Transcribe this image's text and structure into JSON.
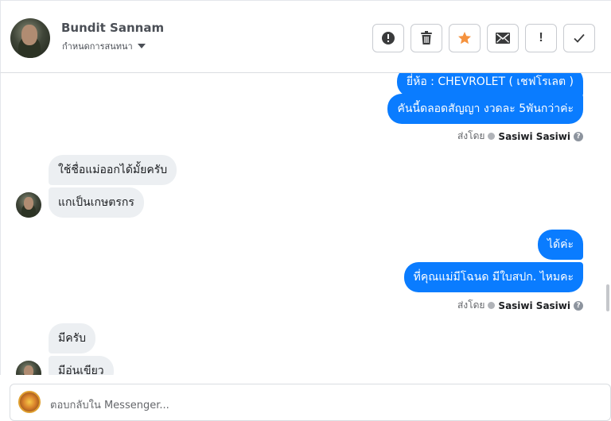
{
  "header": {
    "name": "Bundit Sannam",
    "subtitle": "กำหนดการสนทนา",
    "actions": [
      {
        "icon": "alert-circle-icon",
        "label": ""
      },
      {
        "icon": "trash-icon",
        "label": ""
      },
      {
        "icon": "star-icon",
        "label": ""
      },
      {
        "icon": "envelope-icon",
        "label": ""
      },
      {
        "icon": "exclamation-icon",
        "label": "!"
      },
      {
        "icon": "checkmark-icon",
        "label": ""
      }
    ]
  },
  "thread": {
    "messages": {
      "m1": "ยี่ห้อ : CHEVROLET ( เชฟโรเลต )",
      "m2": "คันนี้ดลอดสัญญา งวดละ 5พันกว่าค่ะ",
      "sent_by_prefix": "ส่งโดย",
      "sent_by_name": "Sasiwi Sasiwi",
      "m3": "ใช้ชื่อแม่ออกได้มั้ยครับ",
      "m4": "แกเป็นเกษตรกร",
      "m5": "ได้ค่ะ",
      "m6": "ที่คุณแม่มีโฉนด มีใบสปก. ไหมคะ",
      "sent_by_prefix_2": "ส่งโดย",
      "sent_by_name_2": "Sasiwi Sasiwi",
      "m7": "มีครับ",
      "m8": "มีอ่นเขียว"
    }
  },
  "composer": {
    "placeholder": "ตอบกลับใน Messenger..."
  },
  "colors": {
    "outgoing": "#0a7cff",
    "incoming": "#eceff2",
    "star": "#f5923e"
  }
}
